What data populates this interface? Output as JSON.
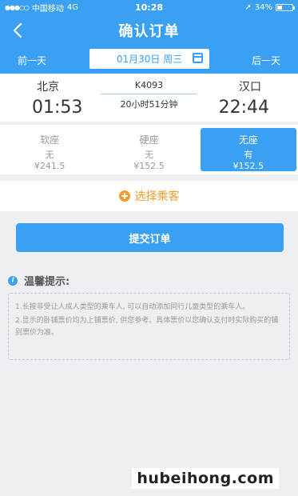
{
  "status_bar": {
    "carrier": "中国移动",
    "network": "4G",
    "time": "10:28",
    "battery_text": "34%",
    "battery_level": 0.34
  },
  "nav": {
    "title": "确认订单",
    "back_icon": "chevron-left-icon"
  },
  "date_bar": {
    "prev_label": "前一天",
    "date_label": "01月30日 周三",
    "next_label": "后一天",
    "calendar_icon": "calendar-icon"
  },
  "train": {
    "from_station": "北京",
    "from_time": "01:53",
    "number": "K4093",
    "duration": "20小时51分钟",
    "to_station": "汉口",
    "to_time": "22:44"
  },
  "seats": [
    {
      "name": "软座",
      "availability": "无",
      "price": "¥241.5",
      "selected": false
    },
    {
      "name": "硬座",
      "availability": "无",
      "price": "¥152.5",
      "selected": false
    },
    {
      "name": "无座",
      "availability": "有",
      "price": "¥152.5",
      "selected": true
    }
  ],
  "passenger": {
    "label": "选择乘客"
  },
  "submit": {
    "label": "提交订单"
  },
  "tips": {
    "title": "温馨提示:",
    "items": [
      "1.长按非受让人成人类型的乘车人, 可以自动添加同行儿童类型的乘车人。",
      "2.显示的卧铺票价均为上铺票价, 供您参考。具体票价以您确认支付时实际购买的铺别票价为准。"
    ]
  },
  "watermark": "hubeihong.com",
  "colors": {
    "primary": "#3aa0f4",
    "accent": "#f39c2c",
    "background": "#eeeff3"
  }
}
